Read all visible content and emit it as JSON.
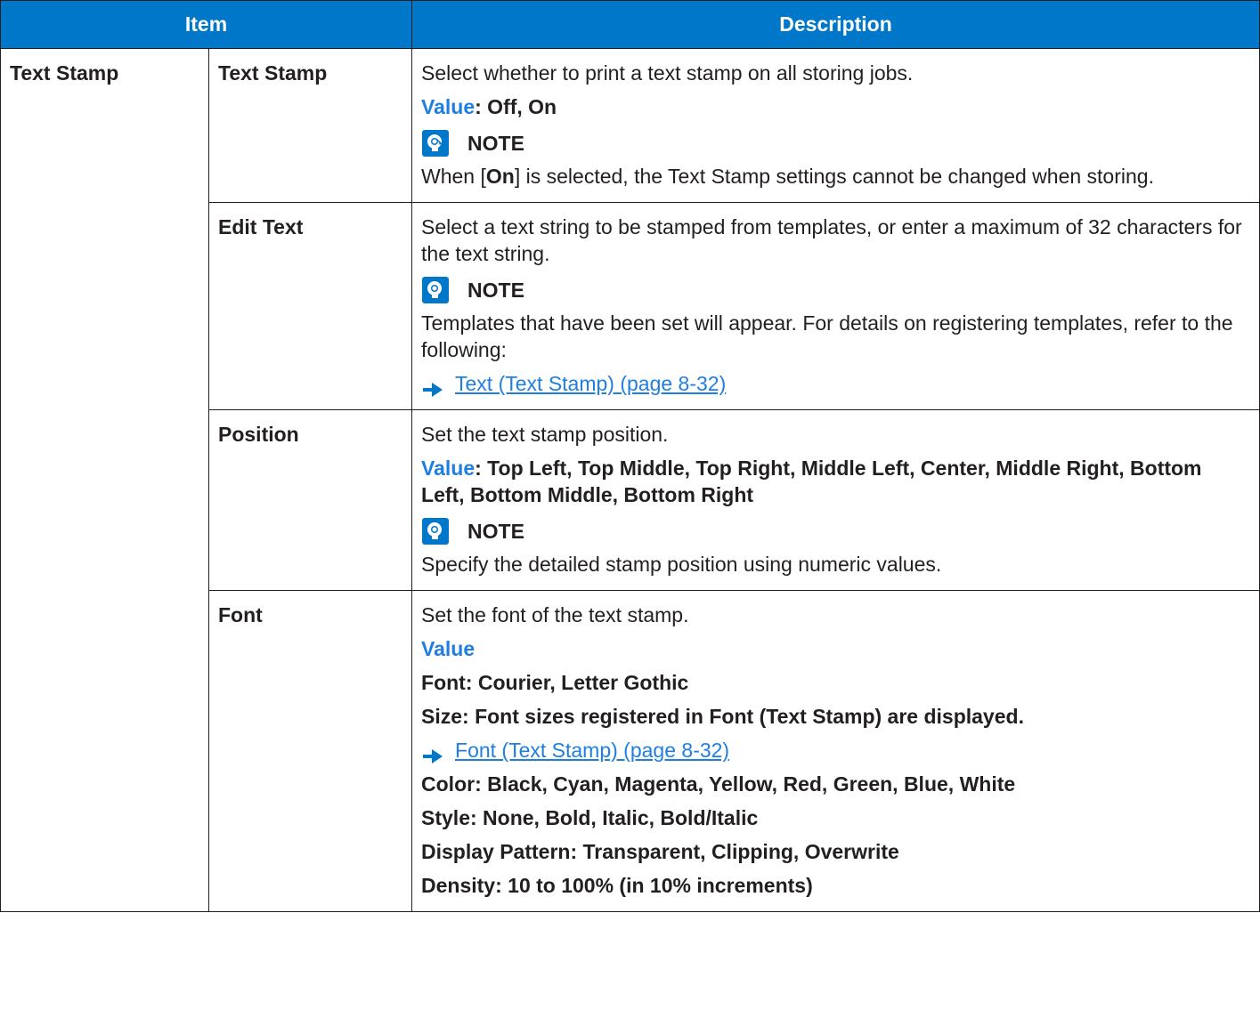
{
  "header": {
    "item": "Item",
    "description": "Description"
  },
  "category": "Text Stamp",
  "rows": {
    "text_stamp": {
      "label": "Text Stamp",
      "desc": "Select whether to print a text stamp on all storing jobs.",
      "value_label": "Value",
      "value_text": ": Off, On",
      "note_title": "NOTE",
      "note_pre": "When [",
      "note_bold": "On",
      "note_post": "] is selected, the Text Stamp settings cannot be changed when storing."
    },
    "edit_text": {
      "label": "Edit Text",
      "desc": "Select a text string to be stamped from templates, or enter a maximum of 32 characters for the text string.",
      "note_title": "NOTE",
      "note_text": "Templates that have been set will appear. For details on registering templates, refer to the following:",
      "link": "Text (Text Stamp) (page 8-32)"
    },
    "position": {
      "label": "Position",
      "desc": "Set the text stamp position.",
      "value_label": "Value",
      "value_text": ": Top Left, Top Middle, Top Right, Middle Left, Center, Middle Right, Bottom Left, Bottom Middle, Bottom Right",
      "note_title": "NOTE",
      "note_text": "Specify the detailed stamp position using numeric values."
    },
    "font": {
      "label": "Font",
      "desc": "Set the font of the text stamp.",
      "value_label": "Value",
      "font_line": "Font: Courier, Letter Gothic",
      "size_line": "Size: Font sizes registered in Font (Text Stamp) are displayed.",
      "link": "Font (Text Stamp) (page 8-32)",
      "color_line": "Color: Black, Cyan, Magenta, Yellow, Red, Green, Blue, White",
      "style_line": "Style: None, Bold, Italic, Bold/Italic",
      "pattern_line": "Display Pattern: Transparent, Clipping, Overwrite",
      "density_line": "Density: 10 to 100% (in 10% increments)"
    }
  },
  "colors": {
    "header_bg": "#0077c8",
    "value_label": "#1f7fe0",
    "link": "#1f7fe0"
  },
  "icons": {
    "note": "lightbulb-note-icon",
    "link_arrow": "arrow-right-icon"
  }
}
